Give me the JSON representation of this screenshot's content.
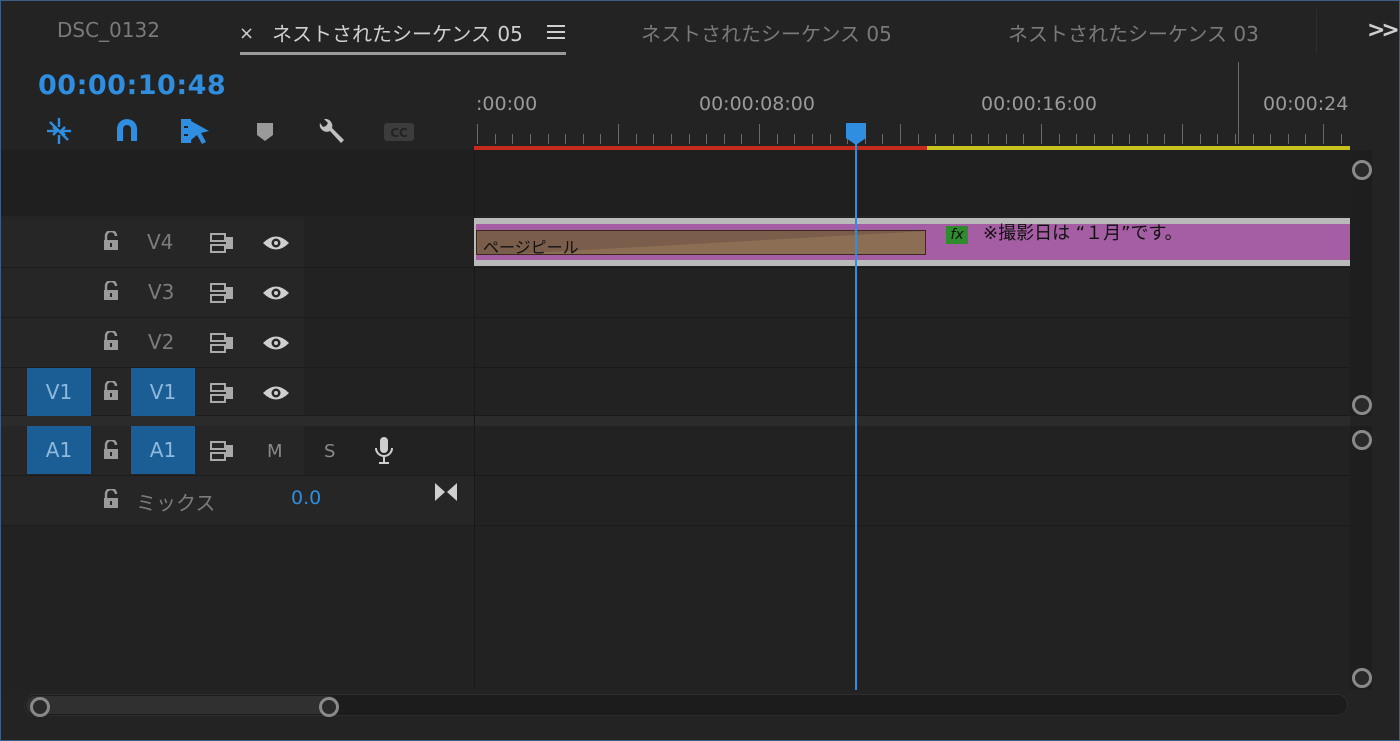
{
  "tabs": [
    {
      "label": "DSC_0132",
      "active": false
    },
    {
      "label": "ネストされたシーケンス 05",
      "active": true
    },
    {
      "label": "ネストされたシーケンス 05",
      "active": false
    },
    {
      "label": "ネストされたシーケンス 03",
      "active": false
    }
  ],
  "tab_close_glyph": "×",
  "timecode": "00:00:10:48",
  "tools": [
    "ripple-icon",
    "snap-magnet-icon",
    "linked-selection-icon",
    "marker-icon",
    "wrench-icon",
    "captions-icon"
  ],
  "ruler": {
    "labels": [
      ":00:00",
      "00:00:08:00",
      "00:00:16:00",
      "00:00:24"
    ]
  },
  "video_tracks": [
    {
      "name": "V4",
      "source": "",
      "targeted": false
    },
    {
      "name": "V3",
      "source": "",
      "targeted": false
    },
    {
      "name": "V2",
      "source": "",
      "targeted": false
    },
    {
      "name": "V1",
      "source": "V1",
      "targeted": true
    }
  ],
  "audio_track": {
    "name": "A1",
    "source": "A1",
    "mute": "M",
    "solo": "S"
  },
  "mix": {
    "label": "ミックス",
    "value": "0.0"
  },
  "clip": {
    "transition_label": "ページピール",
    "fx_label": "fx",
    "title": "※撮影日は “１月”です。",
    "color": "#a55ea3"
  },
  "colors": {
    "accent": "#2f8ee0",
    "render_red": "#c62a1a",
    "render_yellow": "#c8c21c"
  }
}
